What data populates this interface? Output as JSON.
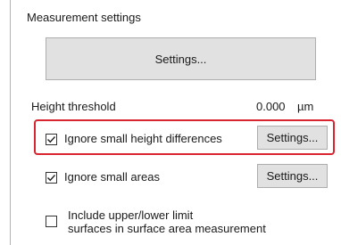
{
  "panel": {
    "section_title": "Measurement settings",
    "main_settings_button": "Settings...",
    "height_threshold": {
      "label": "Height threshold",
      "value": "0.000",
      "unit": "µm"
    },
    "options": [
      {
        "label": "Ignore small height differences",
        "checked": true,
        "button": "Settings...",
        "highlighted": true
      },
      {
        "label": "Ignore small areas",
        "checked": true,
        "button": "Settings..."
      },
      {
        "label_line1": "Include upper/lower limit",
        "label_line2": "surfaces in surface area measurement",
        "checked": false
      }
    ]
  },
  "colors": {
    "highlight": "#d9252f",
    "button_face": "#e1e1e1",
    "button_border": "#adadad"
  },
  "icons": {
    "check": "check-icon"
  }
}
